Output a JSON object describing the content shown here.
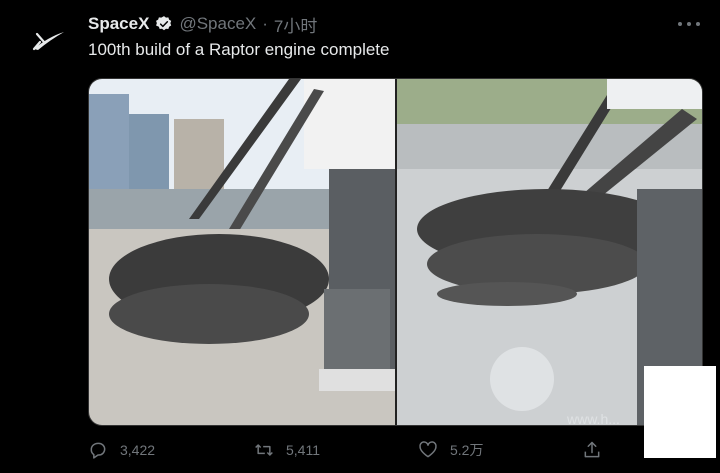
{
  "tweet": {
    "display_name": "SpaceX",
    "handle": "@SpaceX",
    "separator": "·",
    "time": "7小时",
    "text": "100th build of a Raptor engine complete"
  },
  "media": {
    "photos": [
      {
        "description": "team photo left"
      },
      {
        "description": "team photo right"
      }
    ],
    "watermark_text": "www.h..."
  },
  "actions": {
    "reply_count": "3,422",
    "retweet_count": "5,411",
    "like_count": "5.2万"
  },
  "colors": {
    "background": "#000000",
    "text": "#e7e9ea",
    "muted": "#71767b",
    "verified": "#e7e9ea"
  },
  "icons": [
    "spacex-logo-icon",
    "verified-badge-icon",
    "more-icon",
    "reply-icon",
    "retweet-icon",
    "like-icon",
    "share-icon"
  ]
}
